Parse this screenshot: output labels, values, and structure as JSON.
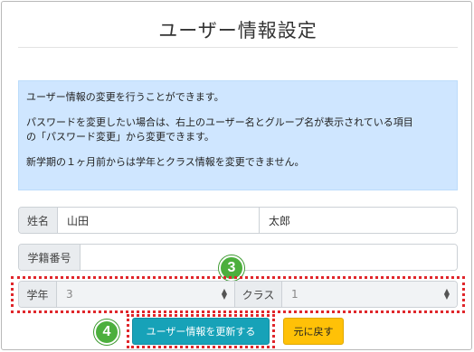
{
  "page": {
    "title": "ユーザー情報設定"
  },
  "info": {
    "line1": "ユーザー情報の変更を行うことができます。",
    "line2a": "パスワードを変更したい場合は、右上のユーザー名とグループ名が表示されている項目",
    "line2b": "の「パスワード変更」から変更できます。",
    "line3": "新学期の１ヶ月前からは学年とクラス情報を変更できません。"
  },
  "form": {
    "name_label": "姓名",
    "last_name": "山田",
    "first_name": "太郎",
    "student_id_label": "学籍番号",
    "student_id_value": "",
    "grade_label": "学年",
    "grade_value": "3",
    "class_label": "クラス",
    "class_value": "1"
  },
  "buttons": {
    "update_label": "ユーザー情報を更新する",
    "back_label": "元に戻す"
  },
  "callouts": {
    "step3": "3",
    "step4": "4"
  },
  "colors": {
    "alert_bg": "#cfe6ff",
    "primary": "#17a2b8",
    "warning": "#ffc107",
    "highlight": "#e0262b",
    "badge": "#4caf3d"
  }
}
